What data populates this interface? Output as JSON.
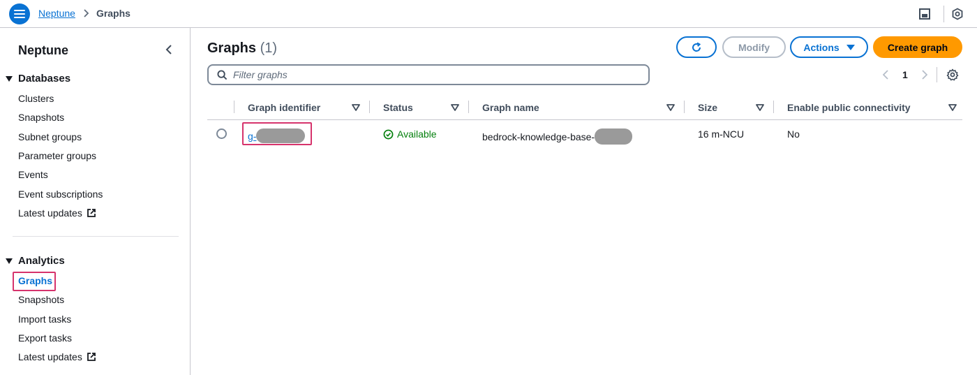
{
  "breadcrumb": {
    "root": "Neptune",
    "current": "Graphs"
  },
  "sidebar": {
    "title": "Neptune",
    "sections": [
      {
        "label": "Databases",
        "items": [
          {
            "label": "Clusters"
          },
          {
            "label": "Snapshots"
          },
          {
            "label": "Subnet groups"
          },
          {
            "label": "Parameter groups"
          },
          {
            "label": "Events"
          },
          {
            "label": "Event subscriptions"
          },
          {
            "label": "Latest updates",
            "external": true
          }
        ]
      },
      {
        "label": "Analytics",
        "items": [
          {
            "label": "Graphs",
            "active": true
          },
          {
            "label": "Snapshots"
          },
          {
            "label": "Import tasks"
          },
          {
            "label": "Export tasks"
          },
          {
            "label": "Latest updates",
            "external": true
          }
        ]
      }
    ]
  },
  "main": {
    "title": "Graphs",
    "count": "(1)",
    "buttons": {
      "modify": "Modify",
      "actions": "Actions",
      "create": "Create graph"
    },
    "filter_placeholder": "Filter graphs",
    "pagination": {
      "page": "1"
    },
    "table": {
      "columns": [
        "Graph identifier",
        "Status",
        "Graph name",
        "Size",
        "Enable public connectivity"
      ],
      "rows": [
        {
          "identifier_prefix": "g-",
          "status": "Available",
          "name_prefix": "bedrock-knowledge-base-",
          "size": "16 m-NCU",
          "public": "No"
        }
      ]
    }
  },
  "colors": {
    "link": "#0972d3",
    "primary": "#ff9900",
    "success": "#037f0c",
    "highlight": "#d6336c"
  },
  "icons": {
    "menu": "hamburger-menu-icon",
    "refresh": "refresh-icon",
    "search": "search-icon",
    "settings": "gear-icon",
    "external": "external-link-icon",
    "status": "check-circle-icon"
  }
}
